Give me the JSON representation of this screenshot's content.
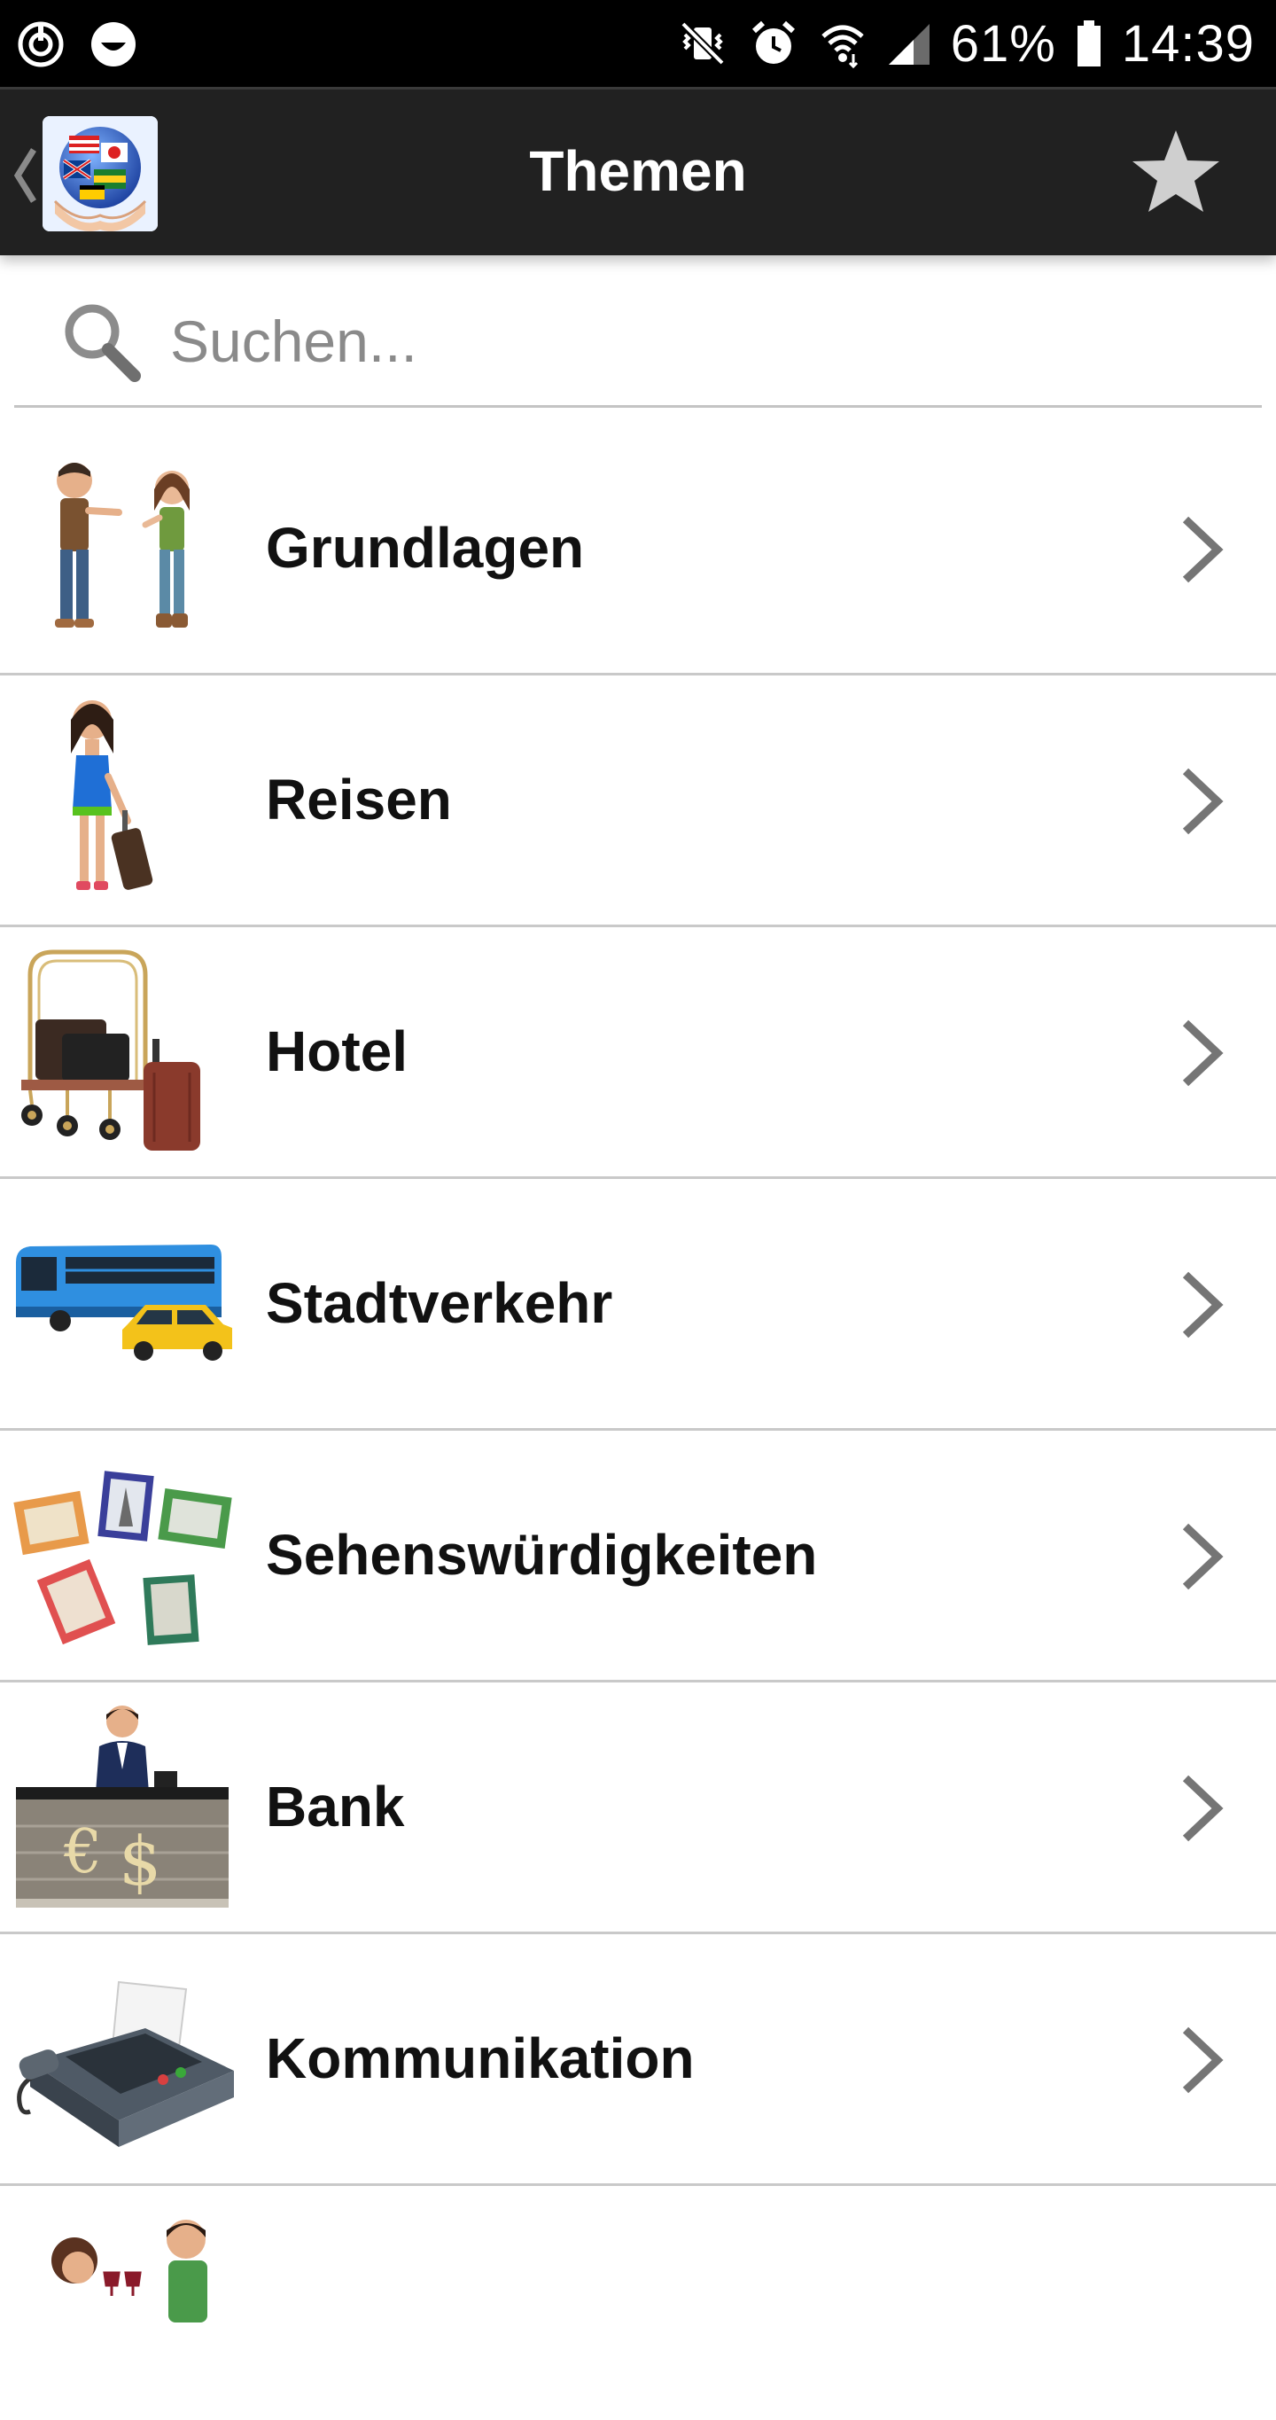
{
  "status_bar": {
    "battery": "61%",
    "time": "14:39"
  },
  "app_bar": {
    "title": "Themen"
  },
  "search": {
    "placeholder": "Suchen..."
  },
  "topics": [
    {
      "label": "Grundlagen"
    },
    {
      "label": "Reisen"
    },
    {
      "label": "Hotel"
    },
    {
      "label": "Stadtverkehr"
    },
    {
      "label": "Sehenswürdigkeiten"
    },
    {
      "label": "Bank"
    },
    {
      "label": "Kommunikation"
    }
  ],
  "colors": {
    "status_bar_bg": "#000000",
    "app_bar_bg": "#212121",
    "divider": "#c9c9c9",
    "chevron": "#757575"
  }
}
